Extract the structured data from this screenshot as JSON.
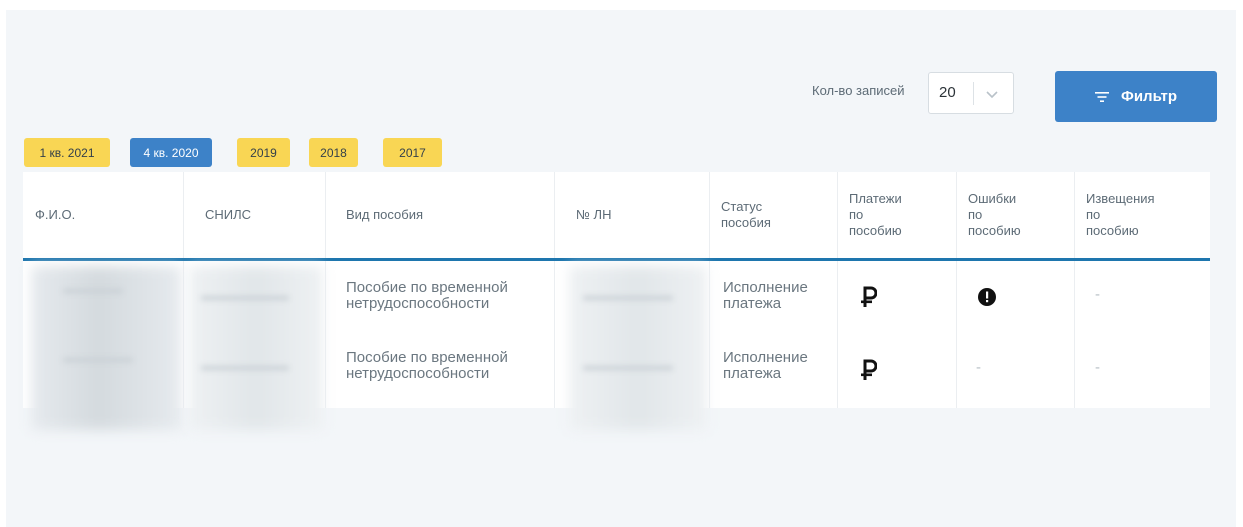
{
  "toolbar": {
    "records_label": "Кол-во записей",
    "records_value": "20",
    "filter_label": "Фильтр"
  },
  "periods": [
    {
      "label": "1 кв. 2021",
      "active": false
    },
    {
      "label": "4 кв. 2020",
      "active": true
    },
    {
      "label": "2019",
      "active": false
    },
    {
      "label": "2018",
      "active": false
    },
    {
      "label": "2017",
      "active": false
    }
  ],
  "table": {
    "columns": {
      "fio": "Ф.И.О.",
      "snils": "СНИЛС",
      "benefit_type": "Вид пособия",
      "ln_number": "№ ЛН",
      "status_1": "Статус",
      "status_2": "пособия",
      "payments_1": "Платежи",
      "payments_2": "по",
      "payments_3": "пособию",
      "errors_1": "Ошибки",
      "errors_2": "по",
      "errors_3": "пособию",
      "notices_1": "Извещения",
      "notices_2": "по",
      "notices_3": "пособию"
    },
    "rows": [
      {
        "benefit_1": "Пособие по временной",
        "benefit_2": "нетрудоспособности",
        "status_1": "Исполнение",
        "status_2": "платежа",
        "payment_icon": "ruble-icon",
        "error_icon": "exclamation-icon",
        "notice": "-"
      },
      {
        "benefit_1": "Пособие по временной",
        "benefit_2": "нетрудоспособности",
        "status_1": "Исполнение",
        "status_2": "платежа",
        "payment_icon": "ruble-icon",
        "error": "-",
        "notice": "-"
      }
    ]
  },
  "colors": {
    "accent": "#3d82c8",
    "chip": "#f9d654",
    "header_line": "#1e76ae",
    "panel": "#f3f6f9"
  }
}
